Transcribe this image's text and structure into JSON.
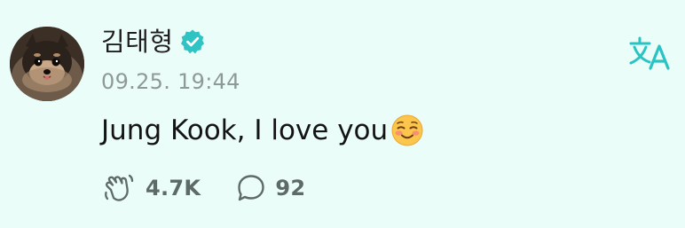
{
  "post": {
    "author_name": "김태형",
    "timestamp": "09.25. 19:44",
    "text": "Jung Kook, I love you",
    "emoji": "relieved-smiling-face-icon"
  },
  "actions": {
    "applause_count": "4.7K",
    "comment_count": "92"
  },
  "colors": {
    "background": "#eafdf8",
    "accent": "#2ac3c3"
  }
}
